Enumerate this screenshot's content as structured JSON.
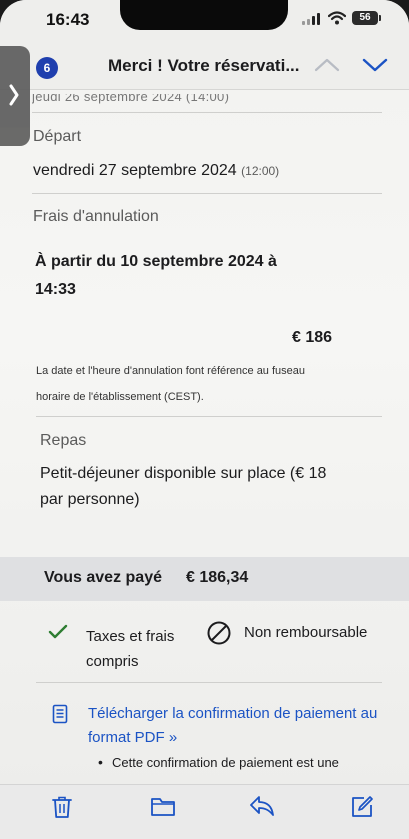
{
  "status": {
    "time": "16:43",
    "battery": "56"
  },
  "nav": {
    "unread_count": "6",
    "title": "Merci ! Votre réservati..."
  },
  "cut_text": "jeudi 26 septembre 2024 (14:00)",
  "departure": {
    "label": "Départ",
    "date": "vendredi 27 septembre 2024",
    "time": "(12:00)"
  },
  "cancellation": {
    "label": "Frais d'annulation",
    "from_text": "À partir du 10 septembre 2024 à 14:33",
    "amount": "€ 186",
    "note": "La date et l'heure d'annulation font référence au fuseau horaire de l'établissement (CEST)."
  },
  "meals": {
    "label": "Repas",
    "text": "Petit-déjeuner disponible sur place (€ 18 par personne)"
  },
  "payment": {
    "label": "Vous avez payé",
    "amount": "€ 186,34"
  },
  "features": {
    "taxes": "Taxes et frais compris",
    "refund": "Non remboursable"
  },
  "download": {
    "link": "Télécharger la confirmation de paiement au format PDF »",
    "bullet": "Cette confirmation de paiement est une"
  },
  "colors": {
    "accent": "#1b53c4",
    "badge": "#1f3fae",
    "check": "#2e7d32"
  },
  "icons": {
    "toolbar": [
      "trash-icon",
      "folder-icon",
      "reply-icon",
      "compose-icon"
    ]
  }
}
